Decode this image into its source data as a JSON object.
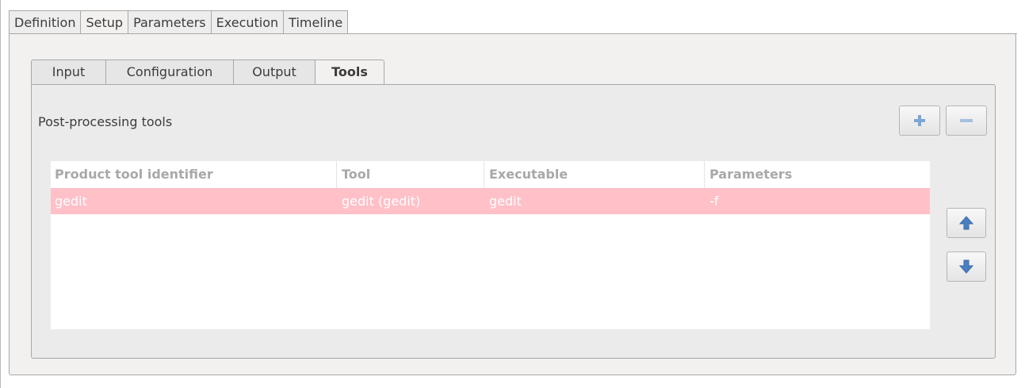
{
  "outer_tabs": [
    {
      "label": "Definition"
    },
    {
      "label": "Setup"
    },
    {
      "label": "Parameters"
    },
    {
      "label": "Execution"
    },
    {
      "label": "Timeline"
    }
  ],
  "outer_active": "Setup",
  "inner_tabs": [
    {
      "label": "Input"
    },
    {
      "label": "Configuration"
    },
    {
      "label": "Output"
    },
    {
      "label": "Tools"
    }
  ],
  "inner_active": "Tools",
  "section": {
    "label": "Post-processing tools"
  },
  "buttons": {
    "add_icon": "plus-icon",
    "remove_icon": "minus-icon",
    "up_icon": "arrow-up-icon",
    "down_icon": "arrow-down-icon"
  },
  "table": {
    "columns": [
      "Product tool identifier",
      "Tool",
      "Executable",
      "Parameters"
    ],
    "rows": [
      [
        "gedit",
        "gedit (gedit)",
        "gedit",
        "-f"
      ]
    ]
  },
  "colors": {
    "selected_row": "#ffc0c8",
    "icon_blue": "#5b8ec9"
  }
}
